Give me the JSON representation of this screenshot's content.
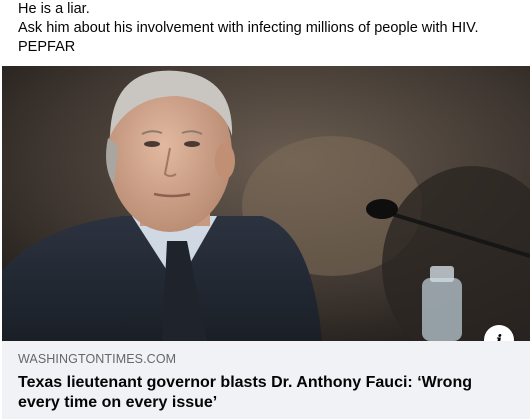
{
  "post": {
    "text_lines": [
      "He is a liar.",
      "Ask him about his involvement with infecting millions of people with HIV.",
      "PEPFAR"
    ]
  },
  "link_preview": {
    "image_icon": "info-icon",
    "info_glyph": "i",
    "domain": "WASHINGTONTIMES.COM",
    "headline": "Texas lieutenant governor blasts Dr. Anthony Fauci: ‘Wrong every time on every issue’"
  },
  "colors": {
    "text_primary": "#050505",
    "text_secondary": "#65676b",
    "card_background": "#f0f2f5"
  }
}
